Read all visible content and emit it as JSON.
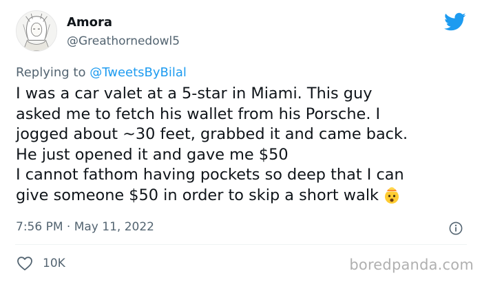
{
  "author": {
    "display_name": "Amora",
    "handle": "@Greathornedowl5"
  },
  "reply": {
    "prefix": "Replying to",
    "mention": "@TweetsByBilal"
  },
  "tweet": {
    "lines": [
      "I was a car valet at a 5-star in Miami. This guy",
      "asked me to fetch his wallet from his Porsche. I",
      "jogged about ~30 feet, grabbed it and came back.",
      "He just opened it and gave me $50",
      "I cannot fathom having pockets so deep that I can",
      "give someone $50 in order to skip a short walk"
    ],
    "emoji": "exploding-head-emoji"
  },
  "timestamp": "7:56 PM · May 11, 2022",
  "likes": {
    "count": "10K",
    "icon": "heart-icon"
  },
  "watermark": "boredpanda.com",
  "icons": {
    "brand": "twitter-bird-icon",
    "info": "info-icon"
  },
  "colors": {
    "text": "#0f1419",
    "secondary": "#536471",
    "accent": "#1d9bf0",
    "divider": "#eff3f4",
    "watermark": "#b0b0b0"
  }
}
